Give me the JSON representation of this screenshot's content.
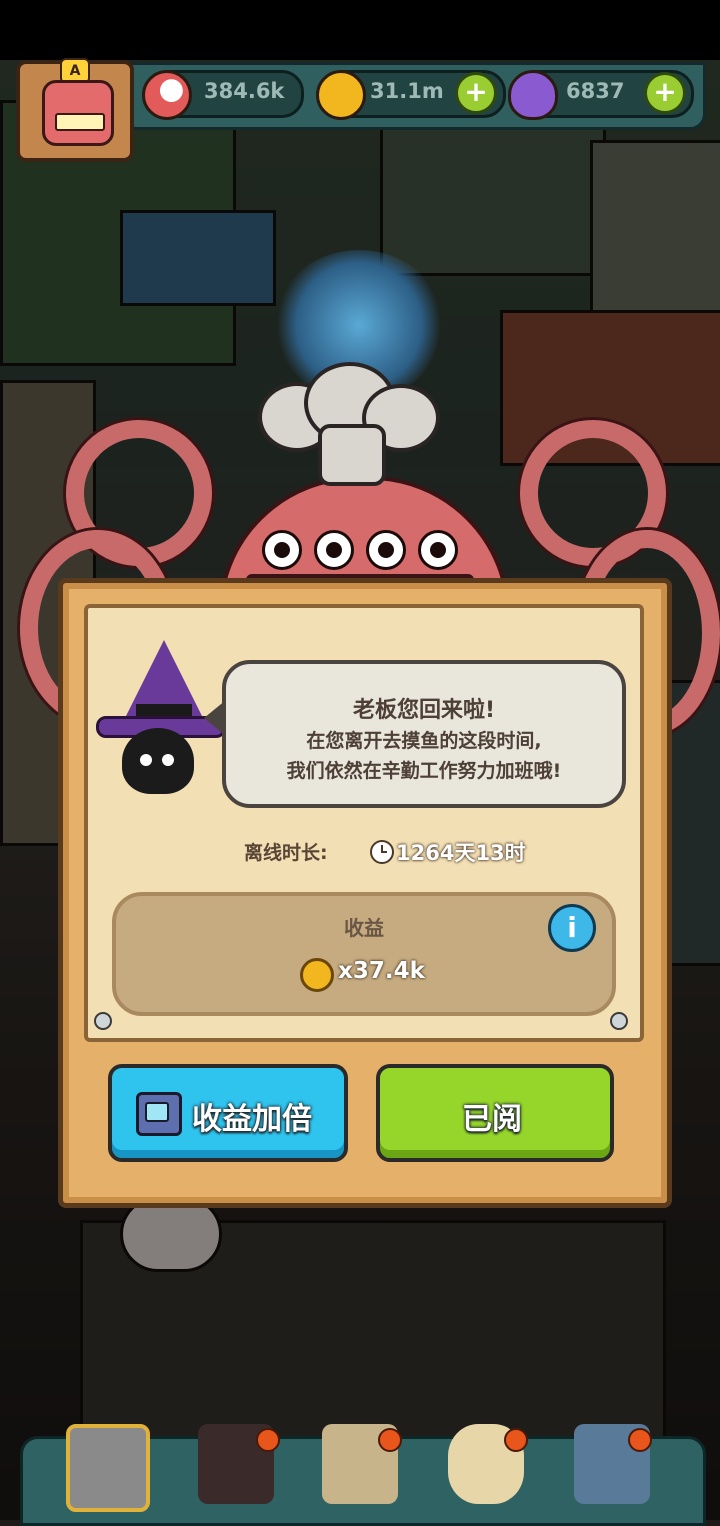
{
  "hud": {
    "avatar_badge": "A",
    "eyeballs": "384.6k",
    "coins": "31.1m",
    "potions": "6837",
    "plus_label": "+"
  },
  "dialog": {
    "greeting": "老板您回来啦!",
    "message_line1": "在您离开去摸鱼的这段时间,",
    "message_line2": "我们依然在辛勤工作努力加班哦!",
    "offline_label": "离线时长:",
    "offline_value": "1264天13时",
    "earnings_title": "收益",
    "earnings_value": "x37.4k",
    "info_label": "i",
    "double_button": "收益加倍",
    "read_button": "已阅"
  },
  "colors": {
    "panel_wood": "#e5b069",
    "double_button": "#2fc4ee",
    "read_button": "#96d62a",
    "octopus": "#d66b6b"
  },
  "icons": [
    "eyeball-icon",
    "coin-icon",
    "potion-icon",
    "plus-icon",
    "clock-icon",
    "info-icon",
    "tv-icon",
    "witch-icon"
  ],
  "bottom_nav": [
    "restaurant",
    "monster",
    "recipe-book",
    "coin-bag",
    "menu-grid"
  ]
}
